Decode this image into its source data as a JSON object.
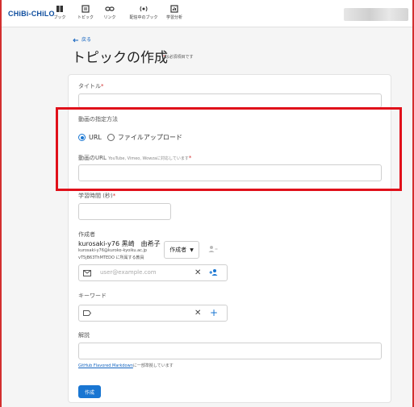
{
  "app": {
    "brand": "CHiBi-CHiLO"
  },
  "nav": [
    {
      "label": "ブック",
      "icon": "book-icon"
    },
    {
      "label": "トピック",
      "icon": "topic-icon"
    },
    {
      "label": "リンク",
      "icon": "link-icon"
    },
    {
      "label": "配信中のブック",
      "icon": "broadcast-icon"
    },
    {
      "label": "学習分析",
      "icon": "analytics-icon"
    }
  ],
  "header": {
    "back_label": "戻る",
    "title": "トピックの作成",
    "required_note_mark": "*",
    "required_note": "は必須項目です"
  },
  "form": {
    "title_label": "タイトル",
    "required_mark": "*",
    "video_method_label": "動画の指定方法",
    "video_method_options": [
      "URL",
      "ファイルアップロード"
    ],
    "video_method_selected": "URL",
    "video_url_label": "動画のURL",
    "video_url_hint": "YouTube, Vimeo, Wowzaに対応しています",
    "duration_label": "学習時間 (秒)",
    "author_label": "作成者",
    "author_name": "kurosaki-y76 黒崎　由希子",
    "author_email": "kurosaki-y76@kuroko-kyoiku.ac.jp",
    "author_org": "vT5jB63ThMTEDO に所属する教員",
    "author_role": "作成者",
    "coauthor_placeholder": "user@example.com",
    "keyword_label": "キーワード",
    "description_label": "解説",
    "markdown_link": "GitHub Flavored Markdown",
    "markdown_note": "に一部準拠しています",
    "submit_label": "作成"
  },
  "colors": {
    "brand": "#0d4d9e",
    "primary": "#1976d2",
    "highlight": "#e0101a",
    "required": "#d32f2f"
  }
}
